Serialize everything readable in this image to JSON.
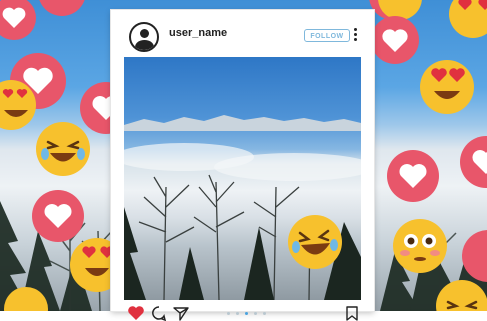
{
  "post": {
    "username": "user_name",
    "follow_label": "FOLLOW"
  },
  "carousel": {
    "total_dots": 5,
    "active_dot": 3
  },
  "icons": {
    "avatar": "profile-avatar-icon",
    "more": "more-vertical-icon",
    "like": "heart-icon",
    "comment": "comment-icon",
    "share": "send-icon",
    "bookmark": "bookmark-icon",
    "reactions": [
      "heart-reaction-icon",
      "laughing-emoji-icon",
      "heart-eyes-emoji-icon",
      "flushed-emoji-icon"
    ]
  },
  "colors": {
    "like_red": "#e0313f",
    "reaction_circle": "#e8566a",
    "follow_blue": "#7fb8dc",
    "emoji_yellow": "#f7c12d"
  }
}
